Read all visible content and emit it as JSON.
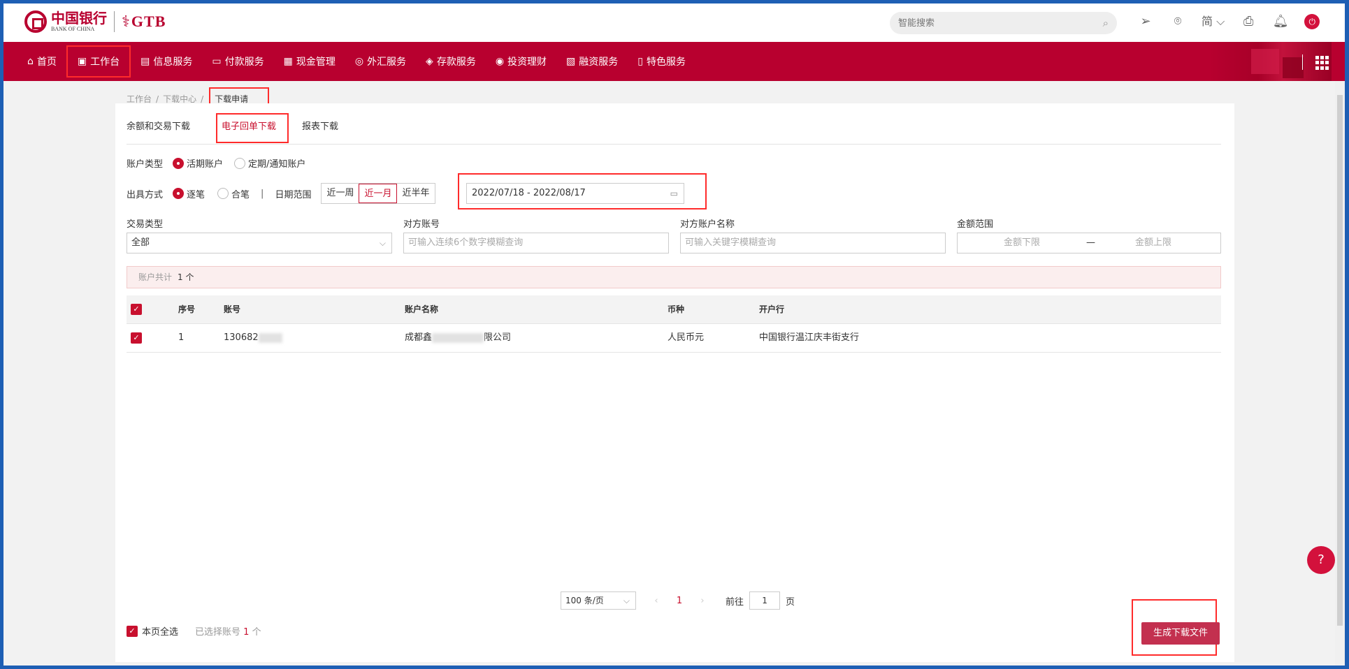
{
  "brand": {
    "logo_cn": "中国银行",
    "logo_en": "BANK OF CHINA",
    "gtb": "GTB"
  },
  "search": {
    "placeholder": "智能搜索"
  },
  "top_icons": {
    "lang": "简",
    "icons": [
      "send-icon",
      "location-icon",
      "language-icon",
      "print-icon",
      "bell-icon",
      "logout-icon"
    ]
  },
  "nav": {
    "items": [
      {
        "label": "首页",
        "icon": "home-icon"
      },
      {
        "label": "工作台",
        "icon": "dashboard-icon"
      },
      {
        "label": "信息服务",
        "icon": "info-icon"
      },
      {
        "label": "付款服务",
        "icon": "payment-icon"
      },
      {
        "label": "现金管理",
        "icon": "cash-icon"
      },
      {
        "label": "外汇服务",
        "icon": "fx-icon"
      },
      {
        "label": "存款服务",
        "icon": "deposit-icon"
      },
      {
        "label": "投资理财",
        "icon": "invest-icon"
      },
      {
        "label": "融资服务",
        "icon": "finance-icon"
      },
      {
        "label": "特色服务",
        "icon": "special-icon"
      }
    ]
  },
  "breadcrumb": {
    "items": [
      "工作台",
      "下载中心"
    ],
    "current": "下载申请"
  },
  "tabs": [
    {
      "label": "余额和交易下载"
    },
    {
      "label": "电子回单下载"
    },
    {
      "label": "报表下载"
    }
  ],
  "filters": {
    "account_type_label": "账户类型",
    "account_type_options": [
      "活期账户",
      "定期/通知账户"
    ],
    "output_label": "出具方式",
    "output_options": [
      "逐笔",
      "合笔"
    ],
    "date_range_label": "日期范围",
    "date_presets": [
      "近一周",
      "近一月",
      "近半年"
    ],
    "date_value": "2022/07/18 - 2022/08/17",
    "trade_type_label": "交易类型",
    "trade_type_value": "全部",
    "counter_account_label": "对方账号",
    "counter_account_placeholder": "可输入连续6个数字模糊查询",
    "counter_name_label": "对方账户名称",
    "counter_name_placeholder": "可输入关键字模糊查询",
    "amount_label": "金额范围",
    "amount_min_placeholder": "金额下限",
    "amount_dash": "—",
    "amount_max_placeholder": "金额上限"
  },
  "summary": {
    "label": "账户共计",
    "value": "1 个"
  },
  "table": {
    "headers": [
      "序号",
      "账号",
      "账户名称",
      "币种",
      "开户行"
    ],
    "rows": [
      {
        "index": "1",
        "account": "130682",
        "name_prefix": "成都鑫",
        "name_suffix": "限公司",
        "currency": "人民币元",
        "bank": "中国银行温江庆丰街支行"
      }
    ]
  },
  "pagination": {
    "page_size": "100 条/页",
    "current": "1",
    "goto_label": "前往",
    "goto_value": "1",
    "page_unit": "页"
  },
  "footer": {
    "select_all": "本页全选",
    "selected_label": "已选择账号",
    "selected_count": "1",
    "selected_unit": "个",
    "generate_button": "生成下载文件"
  },
  "help": {
    "label": "?"
  },
  "colors": {
    "brand": "#b8002f",
    "accent": "#c8102e",
    "highlight_border": "#ff2b2b"
  }
}
